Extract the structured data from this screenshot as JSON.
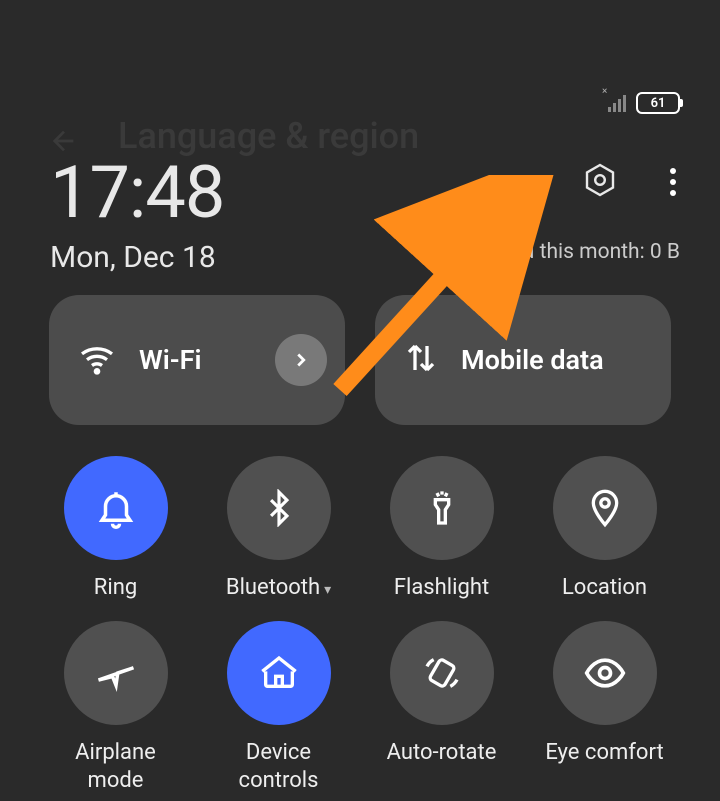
{
  "status": {
    "battery": "61"
  },
  "header": {
    "time": "17:48",
    "date": "Mon, Dec 18",
    "data_usage": "Used this month: 0 B"
  },
  "background": {
    "title": "Language & region"
  },
  "main_tiles": {
    "wifi": {
      "label": "Wi-Fi"
    },
    "mobile_data": {
      "label": "Mobile data"
    }
  },
  "small_tiles": [
    {
      "id": "ring",
      "label": "Ring",
      "active": true
    },
    {
      "id": "bluetooth",
      "label": "Bluetooth",
      "active": false,
      "dropdown": true
    },
    {
      "id": "flashlight",
      "label": "Flashlight",
      "active": false
    },
    {
      "id": "location",
      "label": "Location",
      "active": false
    },
    {
      "id": "airplane",
      "label": "Airplane mode",
      "active": false
    },
    {
      "id": "device-controls",
      "label": "Device controls",
      "active": true
    },
    {
      "id": "auto-rotate",
      "label": "Auto-rotate",
      "active": false
    },
    {
      "id": "eye-comfort",
      "label": "Eye comfort",
      "active": false
    }
  ]
}
